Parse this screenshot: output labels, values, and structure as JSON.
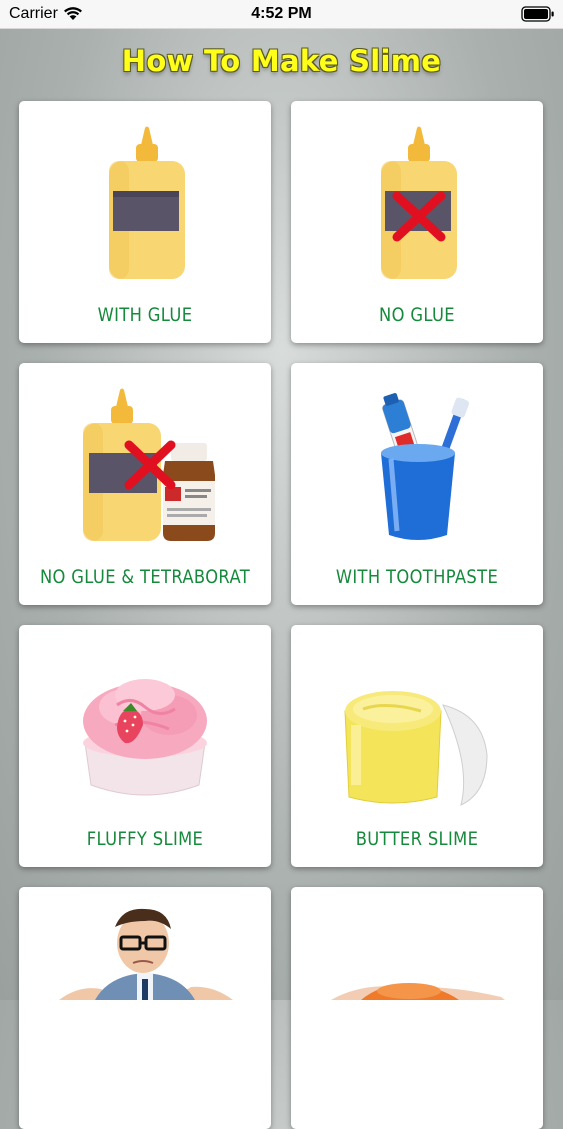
{
  "status_bar": {
    "carrier": "Carrier",
    "time": "4:52 PM",
    "icons": [
      "wifi-icon",
      "battery-icon"
    ]
  },
  "header": {
    "title": "How To Make Slime"
  },
  "colors": {
    "title_fill": "#ffff1a",
    "label_green": "#168a3c",
    "card_bg": "#ffffff"
  },
  "recipes": [
    {
      "label": "WITH GLUE",
      "image": "glue-bottle"
    },
    {
      "label": "NO GLUE",
      "image": "glue-bottle-crossed"
    },
    {
      "label": "NO GLUE & TETRABORAT",
      "image": "glue-crossed-and-medicine-bottle"
    },
    {
      "label": "WITH TOOTHPASTE",
      "image": "toothpaste-cup"
    },
    {
      "label": "FLUFFY SLIME",
      "image": "pink-fluffy-slime"
    },
    {
      "label": "BUTTER SLIME",
      "image": "yellow-butter-slime"
    },
    {
      "label": "",
      "image": "confused-man"
    },
    {
      "label": "",
      "image": "orange-slime-hand"
    }
  ]
}
